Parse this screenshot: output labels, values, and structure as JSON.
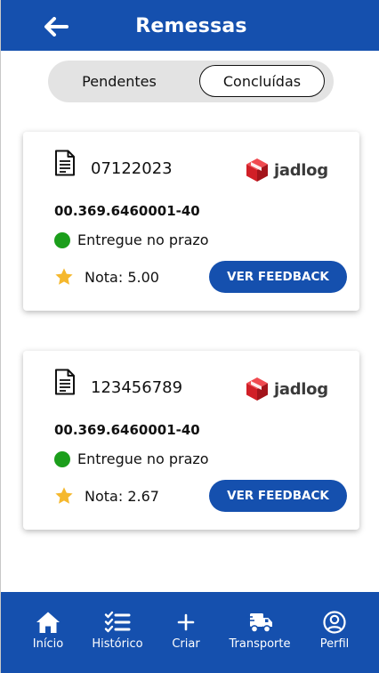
{
  "header": {
    "title": "Remessas"
  },
  "tabs": {
    "pending_label": "Pendentes",
    "done_label": "Concluídas",
    "active": "Concluídas"
  },
  "shipments": [
    {
      "order_id": "07122023",
      "carrier": "jadlog",
      "cnpj": "00.369.6460001-40",
      "status": "Entregue no prazo",
      "rating": "Nota: 5.00",
      "feedback_button": "VER FEEDBACK"
    },
    {
      "order_id": "123456789",
      "carrier": "jadlog",
      "cnpj": "00.369.6460001-40",
      "status": "Entregue no prazo",
      "rating": "Nota: 2.67",
      "feedback_button": "VER FEEDBACK"
    }
  ],
  "nav": [
    {
      "label": "Início",
      "icon": "home-icon"
    },
    {
      "label": "Histórico",
      "icon": "checklist-icon"
    },
    {
      "label": "Criar",
      "icon": "plus-icon"
    },
    {
      "label": "Transporte",
      "icon": "truck-icon"
    },
    {
      "label": "Perfil",
      "icon": "user-icon"
    }
  ],
  "colors": {
    "primary": "#1550ae",
    "status_green": "#1b9e1b",
    "star": "#f5b82e",
    "carrier_red": "#e3262e"
  }
}
